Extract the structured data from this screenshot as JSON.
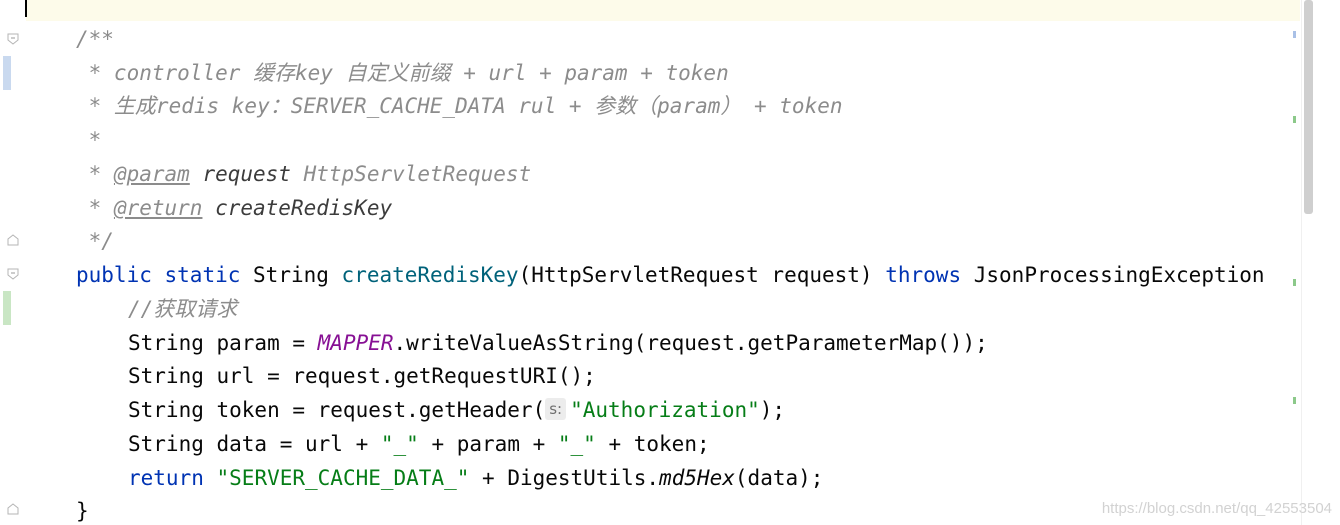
{
  "editor": {
    "lines": [
      {
        "id": "doc-open",
        "text": "/**"
      },
      {
        "id": "doc-line-1",
        "text": " * controller 缓存key 自定义前缀 + url + param + token"
      },
      {
        "id": "doc-line-2",
        "text": " * 生成redis key：SERVER_CACHE_DATA rul + 参数（param） + token"
      },
      {
        "id": "doc-line-3",
        "text": " *"
      },
      {
        "id": "doc-param",
        "prefix": " * ",
        "tag": "@param",
        "name": "request",
        "desc": " HttpServletRequest"
      },
      {
        "id": "doc-return",
        "prefix": " * ",
        "tag": "@return",
        "desc": " createRedisKey"
      },
      {
        "id": "doc-close",
        "text": " */"
      }
    ],
    "signature": {
      "public": "public",
      "static": "static",
      "return_type": "String",
      "method_name": "createRedisKey",
      "params": "(HttpServletRequest request)",
      "throws": "throws",
      "exception": "JsonProcessingException"
    },
    "body": {
      "comment": "//获取请求",
      "line1": {
        "decl": "String param = ",
        "const": "MAPPER",
        "rest": ".writeValueAsString(request.getParameterMap());"
      },
      "line2": {
        "text": "String url = request.getRequestURI();"
      },
      "line3": {
        "pre": "String token = request.getHeader(",
        "hint": "s:",
        "str": "\"Authorization\"",
        "post": ");"
      },
      "line4": {
        "pre": "String data = url + ",
        "str1": "\"_\"",
        "mid": " + param + ",
        "str2": "\"_\"",
        "post": " + token;"
      },
      "line5": {
        "kw": "return",
        "str": "\"SERVER_CACHE_DATA_\"",
        "mid": " + DigestUtils.",
        "method": "md5Hex",
        "post": "(data);"
      },
      "close": "}"
    }
  },
  "watermark": "https://blog.csdn.net/qq_42553504",
  "colors": {
    "keyword": "#0033b3",
    "method": "#00627a",
    "string": "#067d17",
    "comment": "#8c8c8c",
    "constant": "#871094",
    "current_line": "#fdfbea"
  },
  "icons": {
    "fold": "fold-arrow-icon",
    "caret": "text-caret"
  }
}
